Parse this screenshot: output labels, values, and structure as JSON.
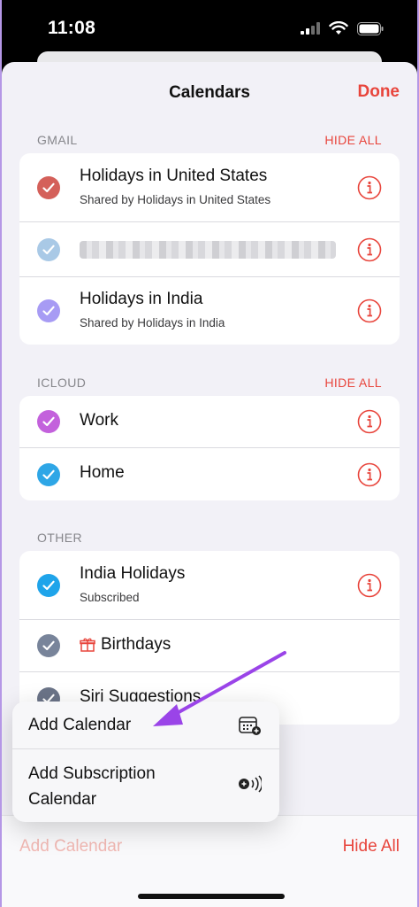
{
  "status": {
    "time": "11:08"
  },
  "nav": {
    "title": "Calendars",
    "done": "Done"
  },
  "sections": {
    "gmail": {
      "title": "GMAIL",
      "action": "HIDE ALL",
      "items": [
        {
          "name": "Holidays in United States",
          "sub": "Shared by Holidays in United States",
          "color": "#d4605a"
        },
        {
          "name": "",
          "sub": "",
          "color": "#a9c9e6"
        },
        {
          "name": "Holidays in India",
          "sub": "Shared by Holidays in India",
          "color": "#a79bf4"
        }
      ]
    },
    "icloud": {
      "title": "ICLOUD",
      "action": "HIDE ALL",
      "items": [
        {
          "name": "Work",
          "color": "#c361dc"
        },
        {
          "name": "Home",
          "color": "#2ea6e6"
        }
      ]
    },
    "other": {
      "title": "OTHER",
      "items": [
        {
          "name": "India Holidays",
          "sub": "Subscribed",
          "color": "#1fa4ea"
        },
        {
          "name": "Birthdays",
          "color": "#78849a"
        },
        {
          "name": "Siri Suggestions",
          "color": "#6b7488"
        }
      ]
    }
  },
  "popup": {
    "add_calendar": "Add Calendar",
    "add_subscription_line1": "Add Subscription",
    "add_subscription_line2": "Calendar"
  },
  "toolbar": {
    "add_calendar": "Add Calendar",
    "hide_all": "Hide All"
  },
  "colors": {
    "accent": "#e8453c",
    "arrow": "#9a44e8"
  }
}
